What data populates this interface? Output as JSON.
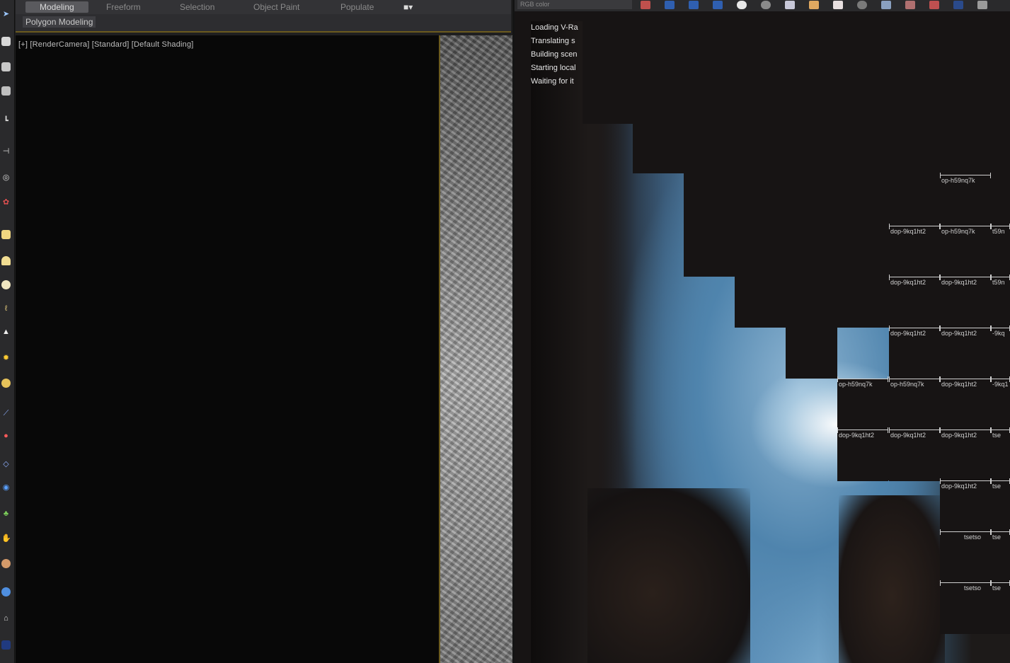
{
  "ribbon": {
    "tabs": [
      "Modeling",
      "Freeform",
      "Selection",
      "Object Paint",
      "Populate"
    ],
    "active_tab": "Modeling",
    "sub_panel": "Polygon Modeling"
  },
  "viewport": {
    "label": "[+] [RenderCamera] [Standard] [Default Shading]"
  },
  "frame_buffer": {
    "channel": "RGB color",
    "log": [
      "Loading V-Ra",
      "Translating s",
      "Building scen",
      "Starting local",
      "Waiting for it"
    ],
    "buckets": [
      {
        "label": "op-h59nq7k"
      },
      {
        "label": "dop-9kq1ht2"
      },
      {
        "label": "op-h59nq7k"
      },
      {
        "label": "t59n"
      },
      {
        "label": "dop-9kq1ht2"
      },
      {
        "label": "dop-9kq1ht2"
      },
      {
        "label": "t59n"
      },
      {
        "label": "dop-9kq1ht2"
      },
      {
        "label": "dop-9kq1ht2"
      },
      {
        "label": "-9kq"
      },
      {
        "label": "op-h59nq7k"
      },
      {
        "label": "op-h59nq7k"
      },
      {
        "label": "dop-9kq1ht2"
      },
      {
        "label": "-9kq1"
      },
      {
        "label": "dop-9kq1ht2"
      },
      {
        "label": "dop-9kq1ht2"
      },
      {
        "label": "dop-9kq1ht2"
      },
      {
        "label": "tse"
      },
      {
        "label": "dop-9kq1ht2"
      },
      {
        "label": "tse"
      },
      {
        "label": "tsetso"
      },
      {
        "label": "tse"
      },
      {
        "label": "tsetso"
      },
      {
        "label": "tse"
      }
    ]
  },
  "colors": {
    "accent": "#6b5a1e",
    "active_btn": "#2f5fb0"
  }
}
